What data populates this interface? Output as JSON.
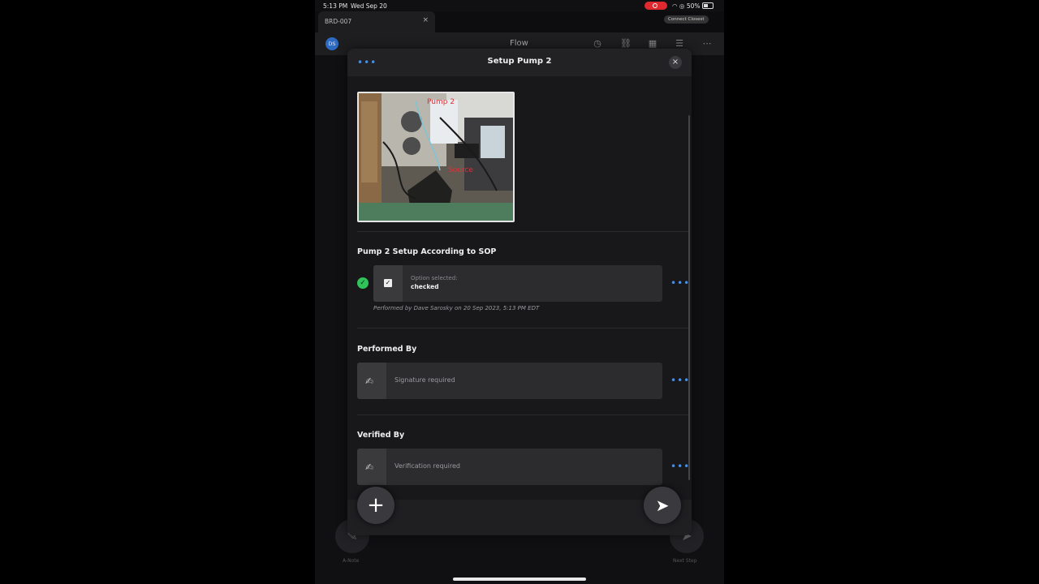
{
  "status_bar": {
    "time": "5:13 PM",
    "date": "Wed Sep 20",
    "battery": "50%"
  },
  "tab": {
    "label": "BRD-007",
    "close": "×"
  },
  "connection_badge": "Connect Closest",
  "app": {
    "avatar_initials": "DS",
    "title": "Flow"
  },
  "bottom": {
    "left_label": "A-Note",
    "right_label": "Next Step"
  },
  "modal": {
    "title": "Setup Pump 2",
    "photo_annotations": {
      "pump": "Pump 2",
      "source": "Source"
    },
    "section1": {
      "title": "Pump 2 Setup According to SOP",
      "option_label": "Option selected:",
      "option_value": "checked",
      "performed_by": "Performed by Dave Sarosky on 20 Sep 2023, 5:13 PM EDT"
    },
    "section2": {
      "title": "Performed By",
      "placeholder": "Signature required"
    },
    "section3": {
      "title": "Verified By",
      "placeholder": "Verification required"
    }
  },
  "icons": {
    "close": "×",
    "more": "•••",
    "add": "+",
    "send": "➤",
    "check": "✓",
    "signature": "✍"
  },
  "colors": {
    "accent": "#4b8fe0",
    "success": "#2fc35a",
    "record": "#e0292e"
  }
}
